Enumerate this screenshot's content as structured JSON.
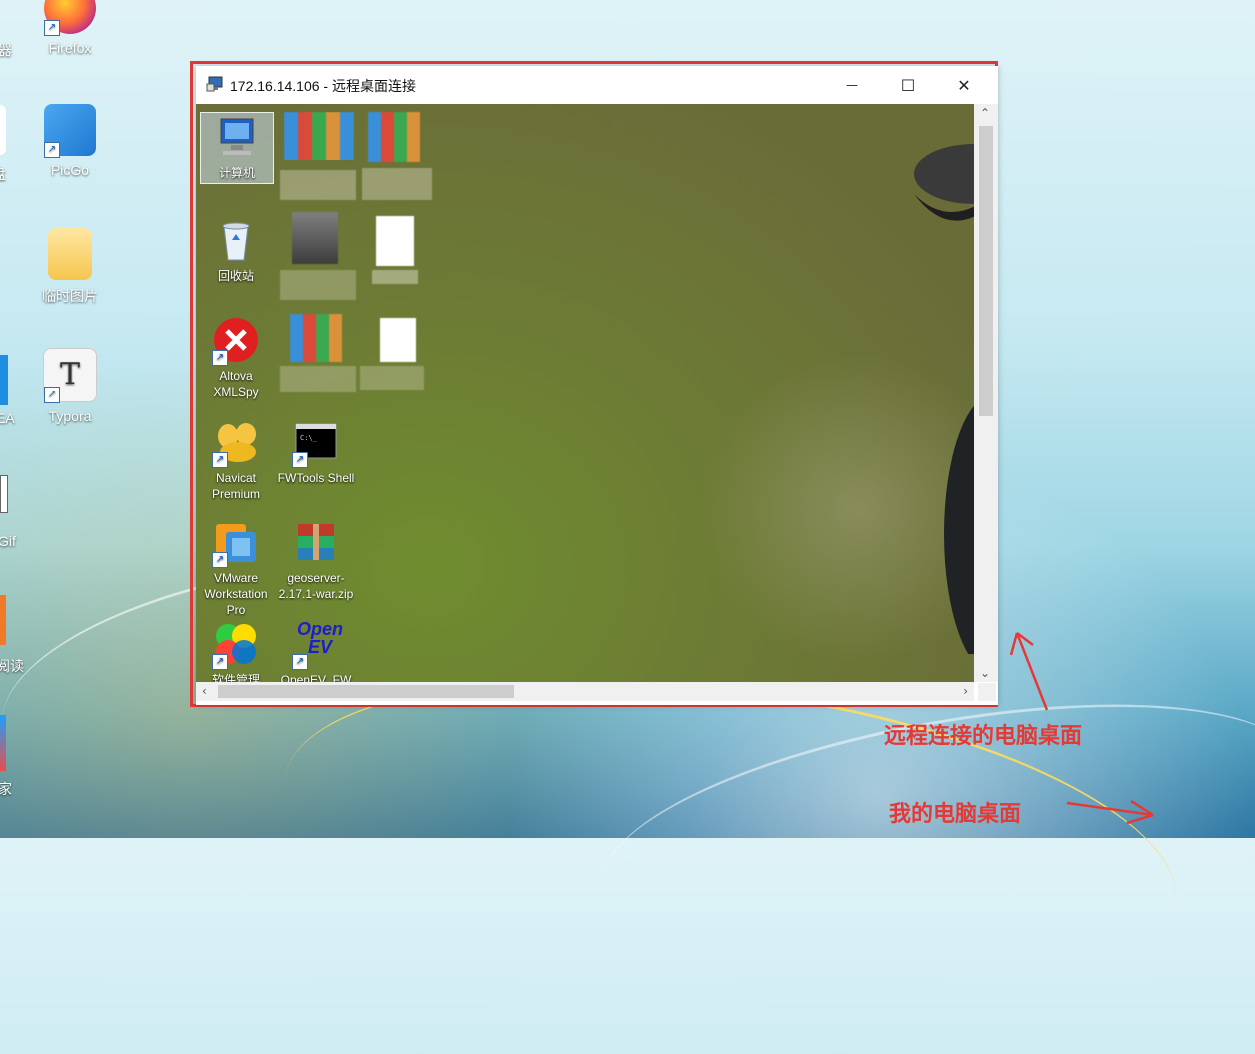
{
  "host_desktop": {
    "icons": [
      {
        "label": "Firefox"
      },
      {
        "label": "PicGo"
      },
      {
        "label": "临时图片"
      },
      {
        "label": "Typora"
      }
    ],
    "partial_labels": [
      "器",
      "盘",
      "EA",
      "Gif",
      "阅读",
      "家"
    ]
  },
  "remote_window": {
    "title": "172.16.14.106 - 远程桌面连接",
    "controls": {
      "minimize": "—",
      "maximize": "☐",
      "close": "✕"
    },
    "icons": [
      {
        "label": "计算机",
        "selected": true
      },
      {
        "label": "回收站"
      },
      {
        "label": "Altova XMLSpy"
      },
      {
        "label": "Navicat Premium"
      },
      {
        "label": "FWTools Shell"
      },
      {
        "label": "VMware Workstation Pro"
      },
      {
        "label": "geoserver-2.17.1-war.zip"
      },
      {
        "label": "软件管理"
      },
      {
        "label": "OpenEV_FW"
      }
    ],
    "openev_logo": "Open EV"
  },
  "annotations": {
    "remote": "远程连接的电脑桌面",
    "local": "我的电脑桌面"
  },
  "colors": {
    "annotation": "#e53935"
  }
}
